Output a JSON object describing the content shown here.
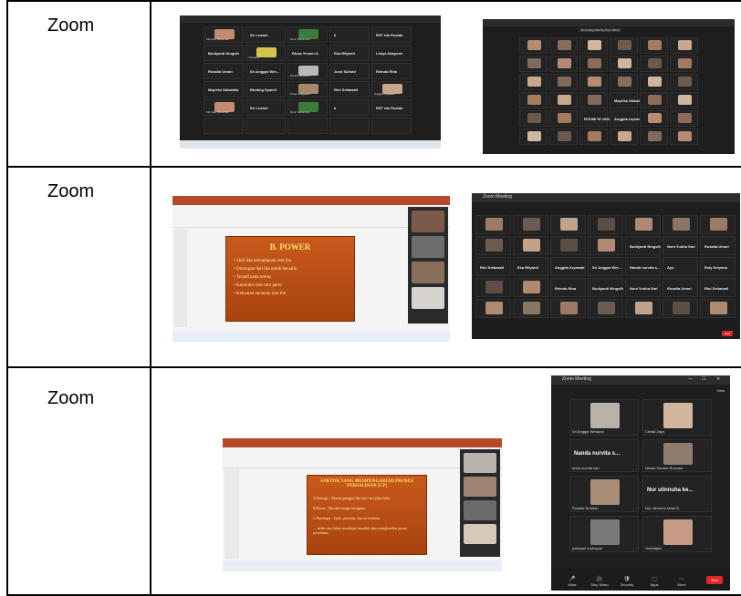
{
  "rows": [
    {
      "label": "Zoom"
    },
    {
      "label": "Zoom"
    },
    {
      "label": "Zoom"
    }
  ],
  "shot1a": {
    "names": [
      "Fitri Ade Wulandari",
      "Sri Lestari",
      "Noni Yudha Sari",
      "k",
      "RST Ida Rosida",
      "Budiyanti Ningsih",
      "Indriana",
      "Rhiza Yesteri A.",
      "Eka Rfiyanti",
      "Listya Ningrum",
      "Rosalia Umari",
      "Sri Anggar Wer...",
      "Nanda nurvita s...",
      "Jumi Sulistri",
      "Reinda Rina",
      "Mayrika Salsabila",
      "Bintang Syamil",
      "Cheer Anggraini",
      "Rini Setiawati",
      "Anggita Aryawati"
    ]
  },
  "shot1b": {
    "title": "Recording Meeting Zoom Work",
    "names": [
      "Yuliana",
      "Rudiyanti Ningsih",
      "Nanda nurvita s...",
      "Nur ulinnuha ke...",
      "Mayrika Salsabila",
      "ROHMI NI JANNAH",
      "Anggita Aryawati"
    ]
  },
  "shot2a": {
    "slide_title": "B. POWER",
    "bullets": [
      "Skill dan kemampuan otot ibu",
      "Dorongan dari ibu untuk bersalin",
      "Terjadi pada uterus",
      "Kontraksi otot-otot perut",
      "Kekuatan meneran dari ibu"
    ]
  },
  "shot2b": {
    "title": "Zoom Meeting",
    "names": [
      "Budiyanti Ningsih",
      "Noni Yudha Sari",
      "Rosalia Umari",
      "Rini Setiawati",
      "Eka Rfiyanti",
      "Anggita Aryawati",
      "Sri Anggar Wer...",
      "Nanda nurvita s...",
      "Ayu",
      "Esty Setyana",
      "Reinda Rina"
    ]
  },
  "shot3a": {
    "slide_title": "FAKTOR YANG MEMPENGARUHI PROSES PERSALINAN (5 P)",
    "bullets": [
      "A.Passage : Ukuran panggul dan otot-otot jalan lahir",
      "B.Power : His dan tenaga mengejan",
      "C.Passenger : Janin, plasenta, dan air ketuban",
      "→ salah satu faktor mendapat masalah akan menghambat proses persalinan"
    ]
  },
  "shot3b": {
    "title": "Zoom Meeting",
    "view": "View",
    "tiles": [
      "Sri Anggar Wer...",
      "Nanda nurvita s...",
      "Nur ulinnuha ke...",
      "Fifi Hikmayanti",
      "Yeshitajwi",
      "Ayu"
    ],
    "labels": [
      "Sri Anggar Werdani",
      "Christi Jaya",
      "anda nurvita sari",
      "Nimas Hanum Rusnani",
      "Rosalia Nuridah",
      "Nur ulinnuha kelas B",
      "patriyani nurhayati",
      "Yeshitajwi"
    ],
    "toolbar": [
      "Mute",
      "Stop Video",
      "Security",
      "Apps",
      "More"
    ],
    "end": "End"
  }
}
